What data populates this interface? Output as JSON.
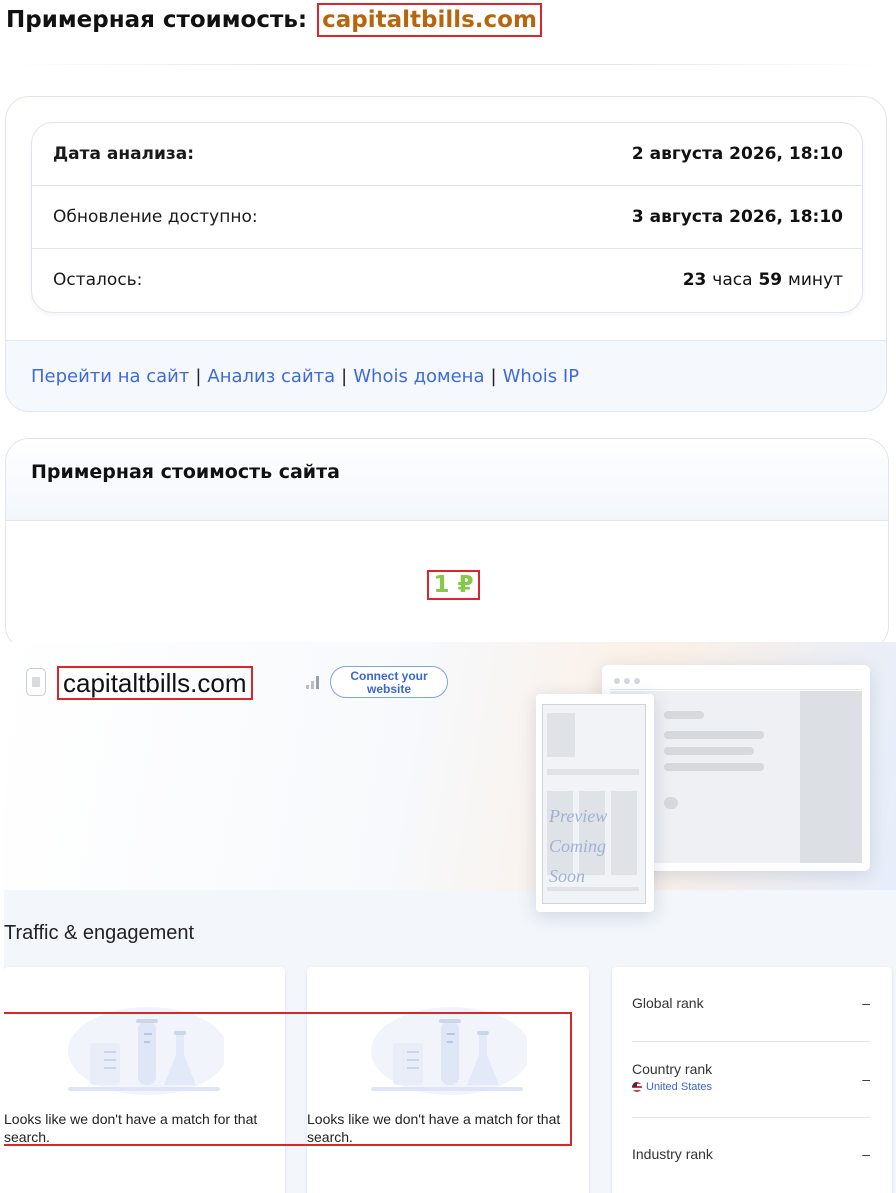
{
  "header": {
    "title_prefix": "Примерная стоимость:",
    "domain": "capitaltbills.com"
  },
  "analysis": {
    "rows": [
      {
        "label": "Дата анализа:",
        "value": "2 августа 2026, 18:10"
      },
      {
        "label": "Обновление доступно:",
        "value": "3 августа 2026, 18:10"
      }
    ],
    "remaining": {
      "label": "Осталось:",
      "hours": "23",
      "hours_unit": "часа",
      "minutes": "59",
      "minutes_unit": "минут"
    }
  },
  "links": [
    {
      "label": "Перейти на сайт"
    },
    {
      "label": "Анализ сайта"
    },
    {
      "label": "Whois домена"
    },
    {
      "label": "Whois IP"
    }
  ],
  "links_separator": "|",
  "valuation": {
    "title": "Примерная стоимость сайта",
    "price": "1 ₽"
  },
  "widget": {
    "site_name": "capitaltbills.com",
    "connect_button": "Connect your website",
    "preview_text": "Preview Coming Soon",
    "traffic_title": "Traffic & engagement",
    "no_match_text": "Looks like we don't have a match for that search.",
    "ranks": [
      {
        "label": "Global rank",
        "value": "–"
      },
      {
        "label": "Country rank",
        "value": "–",
        "country": "United States"
      },
      {
        "label": "Industry rank",
        "value": "–"
      }
    ]
  }
}
